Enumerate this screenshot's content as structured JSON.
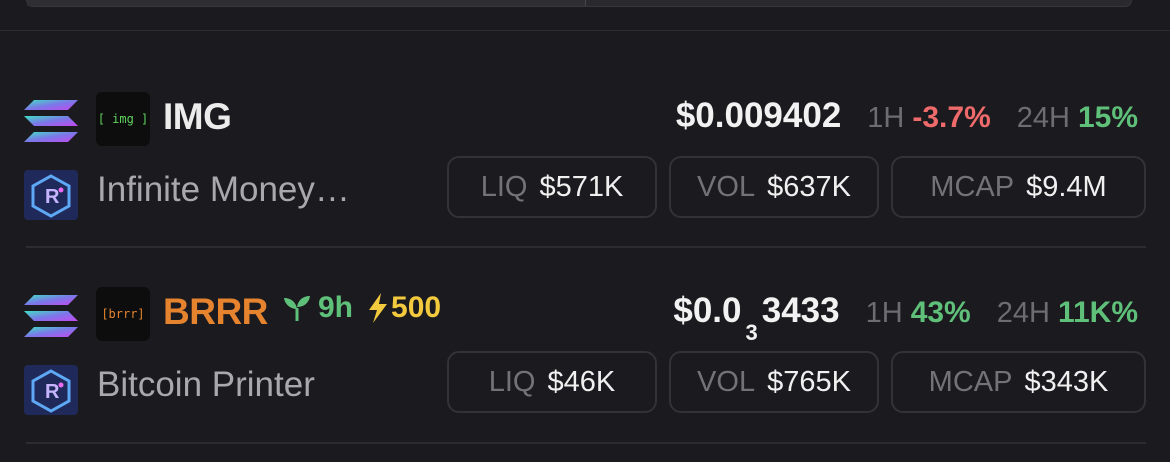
{
  "tokens": [
    {
      "logo_text": "[ img ]",
      "logo_color": "#5fd35f",
      "symbol": "IMG",
      "symbol_color": "#f2f2f2",
      "name": "Infinite Money…",
      "chain_icon": "solana-icon",
      "dex_icon": "raydium-icon",
      "price_main": "$0.009402",
      "price_sub": "",
      "price_tail": "",
      "h1_label": "1H",
      "h1_value": "-3.7%",
      "h1_color": "red",
      "h24_label": "24H",
      "h24_value": "15%",
      "h24_color": "green",
      "liq_label": "LIQ",
      "liq_value": "$571K",
      "vol_label": "VOL",
      "vol_value": "$637K",
      "mcap_label": "MCAP",
      "mcap_value": "$9.4M"
    },
    {
      "logo_text": "[brrr]",
      "logo_color": "#e5832e",
      "symbol": "BRRR",
      "symbol_color": "#e5832e",
      "name": "Bitcoin Printer",
      "chain_icon": "solana-icon",
      "dex_icon": "raydium-icon",
      "age_icon": "seedling-icon",
      "age": "9h",
      "boost_icon": "lightning-icon",
      "boost": "500",
      "price_main": "$0.0",
      "price_sub": "3",
      "price_tail": "3433",
      "h1_label": "1H",
      "h1_value": "43%",
      "h1_color": "green",
      "h24_label": "24H",
      "h24_value": "11K%",
      "h24_color": "green",
      "liq_label": "LIQ",
      "liq_value": "$46K",
      "vol_label": "VOL",
      "vol_value": "$765K",
      "mcap_label": "MCAP",
      "mcap_value": "$343K"
    }
  ]
}
